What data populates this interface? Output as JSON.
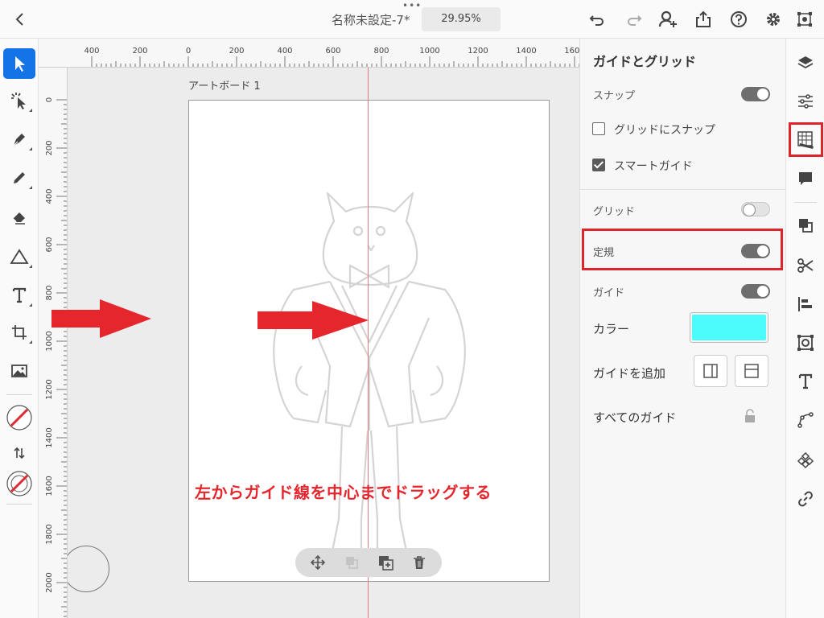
{
  "header": {
    "title": "名称未設定-7*",
    "zoom": "29.95%"
  },
  "ruler": {
    "top_ticks": [
      "400",
      "200",
      "0",
      "200",
      "400",
      "600",
      "800",
      "1000",
      "1200",
      "1400",
      "1600"
    ],
    "left_ticks": [
      "0",
      "200",
      "400",
      "600",
      "800",
      "1000",
      "1200",
      "1400",
      "1600",
      "1800",
      "2000"
    ]
  },
  "canvas": {
    "artboard_label": "アートボード 1",
    "instruction": "左からガイド線を中心までドラッグする"
  },
  "panel": {
    "title": "ガイドとグリッド",
    "snap_label": "スナップ",
    "snap_on": true,
    "snap_to_grid_label": "グリッドにスナップ",
    "snap_to_grid_checked": false,
    "smart_guides_label": "スマートガイド",
    "smart_guides_checked": true,
    "grid_label": "グリッド",
    "grid_on": false,
    "rulers_label": "定規",
    "rulers_on": true,
    "guides_label": "ガイド",
    "guides_on": true,
    "color_label": "カラー",
    "guide_color": "#4cfcfc",
    "add_guide_label": "ガイドを追加",
    "all_guides_label": "すべてのガイド"
  },
  "colors": {
    "accent_blue": "#1473e6",
    "highlight_red": "#e0242b",
    "arrow_red": "#e5262d",
    "guide_line": "#e57a7a"
  },
  "icons": {
    "top_right": [
      "undo-icon",
      "redo-icon",
      "invite-user-icon",
      "share-icon",
      "help-icon",
      "settings-icon",
      "workspace-icon"
    ],
    "left_tools": [
      "select-tool-icon",
      "direct-select-tool-icon",
      "pen-tool-icon",
      "pencil-tool-icon",
      "eraser-tool-icon",
      "shape-tool-icon",
      "type-tool-icon",
      "crop-tool-icon",
      "image-tool-icon",
      "fill-none-icon",
      "swap-icon",
      "stroke-none-icon"
    ],
    "right_strip": [
      "layers-icon",
      "properties-icon",
      "guides-grid-icon",
      "comments-icon",
      "duplicate-icon",
      "cut-icon",
      "align-icon",
      "appearance-icon",
      "text-icon",
      "path-icon",
      "symbol-icon",
      "link-icon"
    ]
  }
}
